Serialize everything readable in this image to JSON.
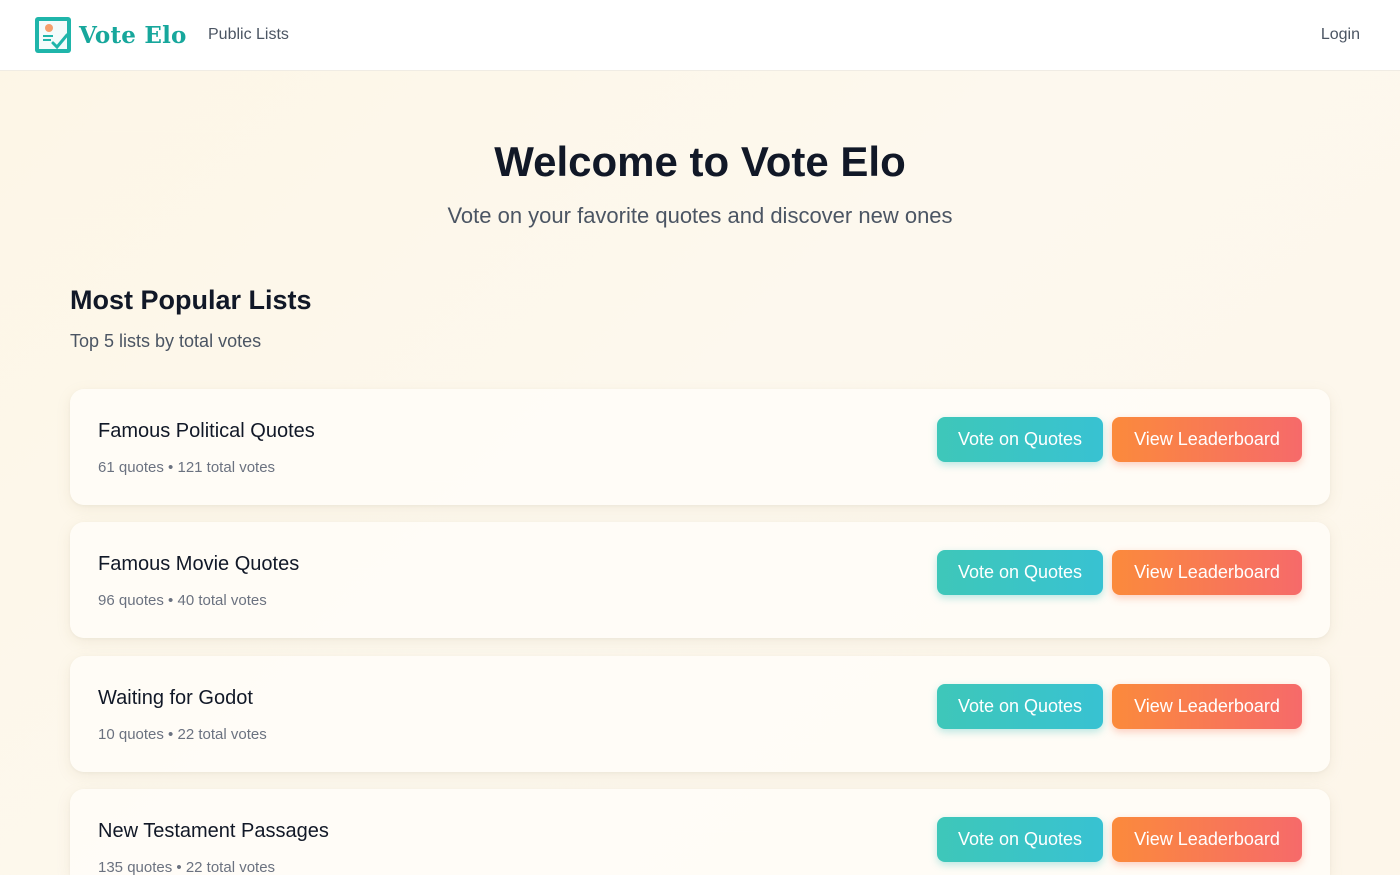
{
  "nav": {
    "brand": "Vote Elo",
    "logo_icon": "ballot-box-icon",
    "public_lists": "Public Lists",
    "login": "Login"
  },
  "hero": {
    "title": "Welcome to Vote Elo",
    "subtitle": "Vote on your favorite quotes and discover new ones"
  },
  "popular": {
    "title": "Most Popular Lists",
    "subtitle": "Top 5 lists by total votes",
    "lists": [
      {
        "title": "Famous Political Quotes",
        "meta": "61 quotes • 121 total votes",
        "vote_label": "Vote on Quotes",
        "board_label": "View Leaderboard"
      },
      {
        "title": "Famous Movie Quotes",
        "meta": "96 quotes • 40 total votes",
        "vote_label": "Vote on Quotes",
        "board_label": "View Leaderboard"
      },
      {
        "title": "Waiting for Godot",
        "meta": "10 quotes • 22 total votes",
        "vote_label": "Vote on Quotes",
        "board_label": "View Leaderboard"
      },
      {
        "title": "New Testament Passages",
        "meta": "135 quotes • 22 total votes",
        "vote_label": "Vote on Quotes",
        "board_label": "View Leaderboard"
      }
    ]
  },
  "colors": {
    "brand_teal": "#17a79c",
    "vote_button": "#3ec7b9",
    "leaderboard_button": "#f97a52",
    "background": "#fdf6e6"
  }
}
